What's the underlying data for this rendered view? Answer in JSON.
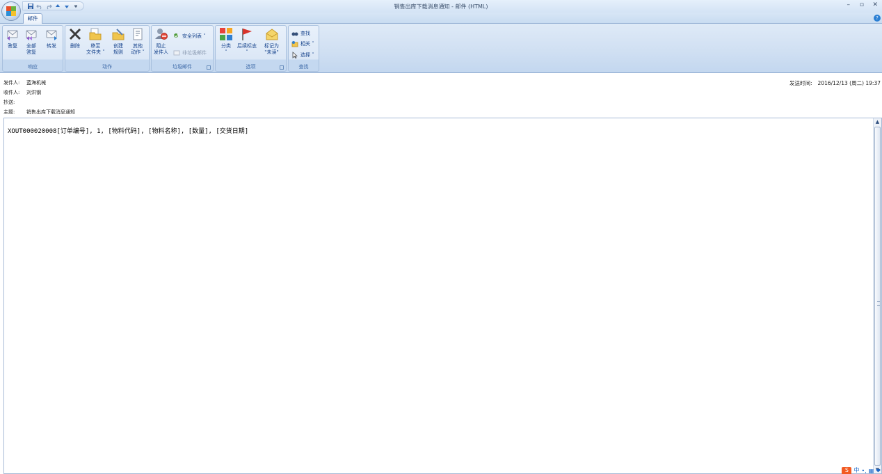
{
  "window": {
    "title": "销售出库下载消息通知 - 邮件 (HTML)",
    "controls": [
      "–",
      "▫",
      "✕"
    ]
  },
  "quick_access": [
    "save-icon",
    "undo-icon",
    "redo-icon",
    "prev-icon",
    "next-icon",
    "customize-icon"
  ],
  "ribbon": {
    "tab": "邮件",
    "groups": {
      "respond": {
        "label": "响应",
        "reply": "答复",
        "reply_all_l1": "全部",
        "reply_all_l2": "答复",
        "forward": "转发"
      },
      "actions": {
        "label": "动作",
        "delete": "删除",
        "move_l1": "移至",
        "move_l2": "文件夹 ˅",
        "rules_l1": "创建",
        "rules_l2": "规则",
        "other_l1": "其他",
        "other_l2": "动作 ˅"
      },
      "junk": {
        "label": "垃圾邮件",
        "block_l1": "阻止",
        "block_l2": "发件人",
        "safe_lists": "安全列表 ˅",
        "not_junk": "非垃圾邮件"
      },
      "options": {
        "label": "选项",
        "categorize_l1": "分类",
        "categorize_l2": "˅",
        "followup_l1": "后续标志",
        "followup_l2": "˅",
        "mark_l1": "标记为",
        "mark_l2": "\"未读\""
      },
      "find": {
        "label": "查找",
        "find": "查找",
        "related": "相关 ˅",
        "select": "选择 ˅"
      }
    }
  },
  "header": {
    "from_label": "发件人:",
    "from": "蓝海机械",
    "to_label": "收件人:",
    "to": "刘洪钢",
    "cc_label": "抄送:",
    "cc": "",
    "subject_label": "主题:",
    "subject": "销售出库下载消息通知",
    "sent_label": "发送时间:",
    "sent": "2016/12/13 (周二) 19:37"
  },
  "body": {
    "text": "XOUT000020008[订单编号], 1, [物料代码], [物料名称], [数量], [交货日期]"
  },
  "ime": {
    "logo": "S",
    "mode": "中"
  }
}
